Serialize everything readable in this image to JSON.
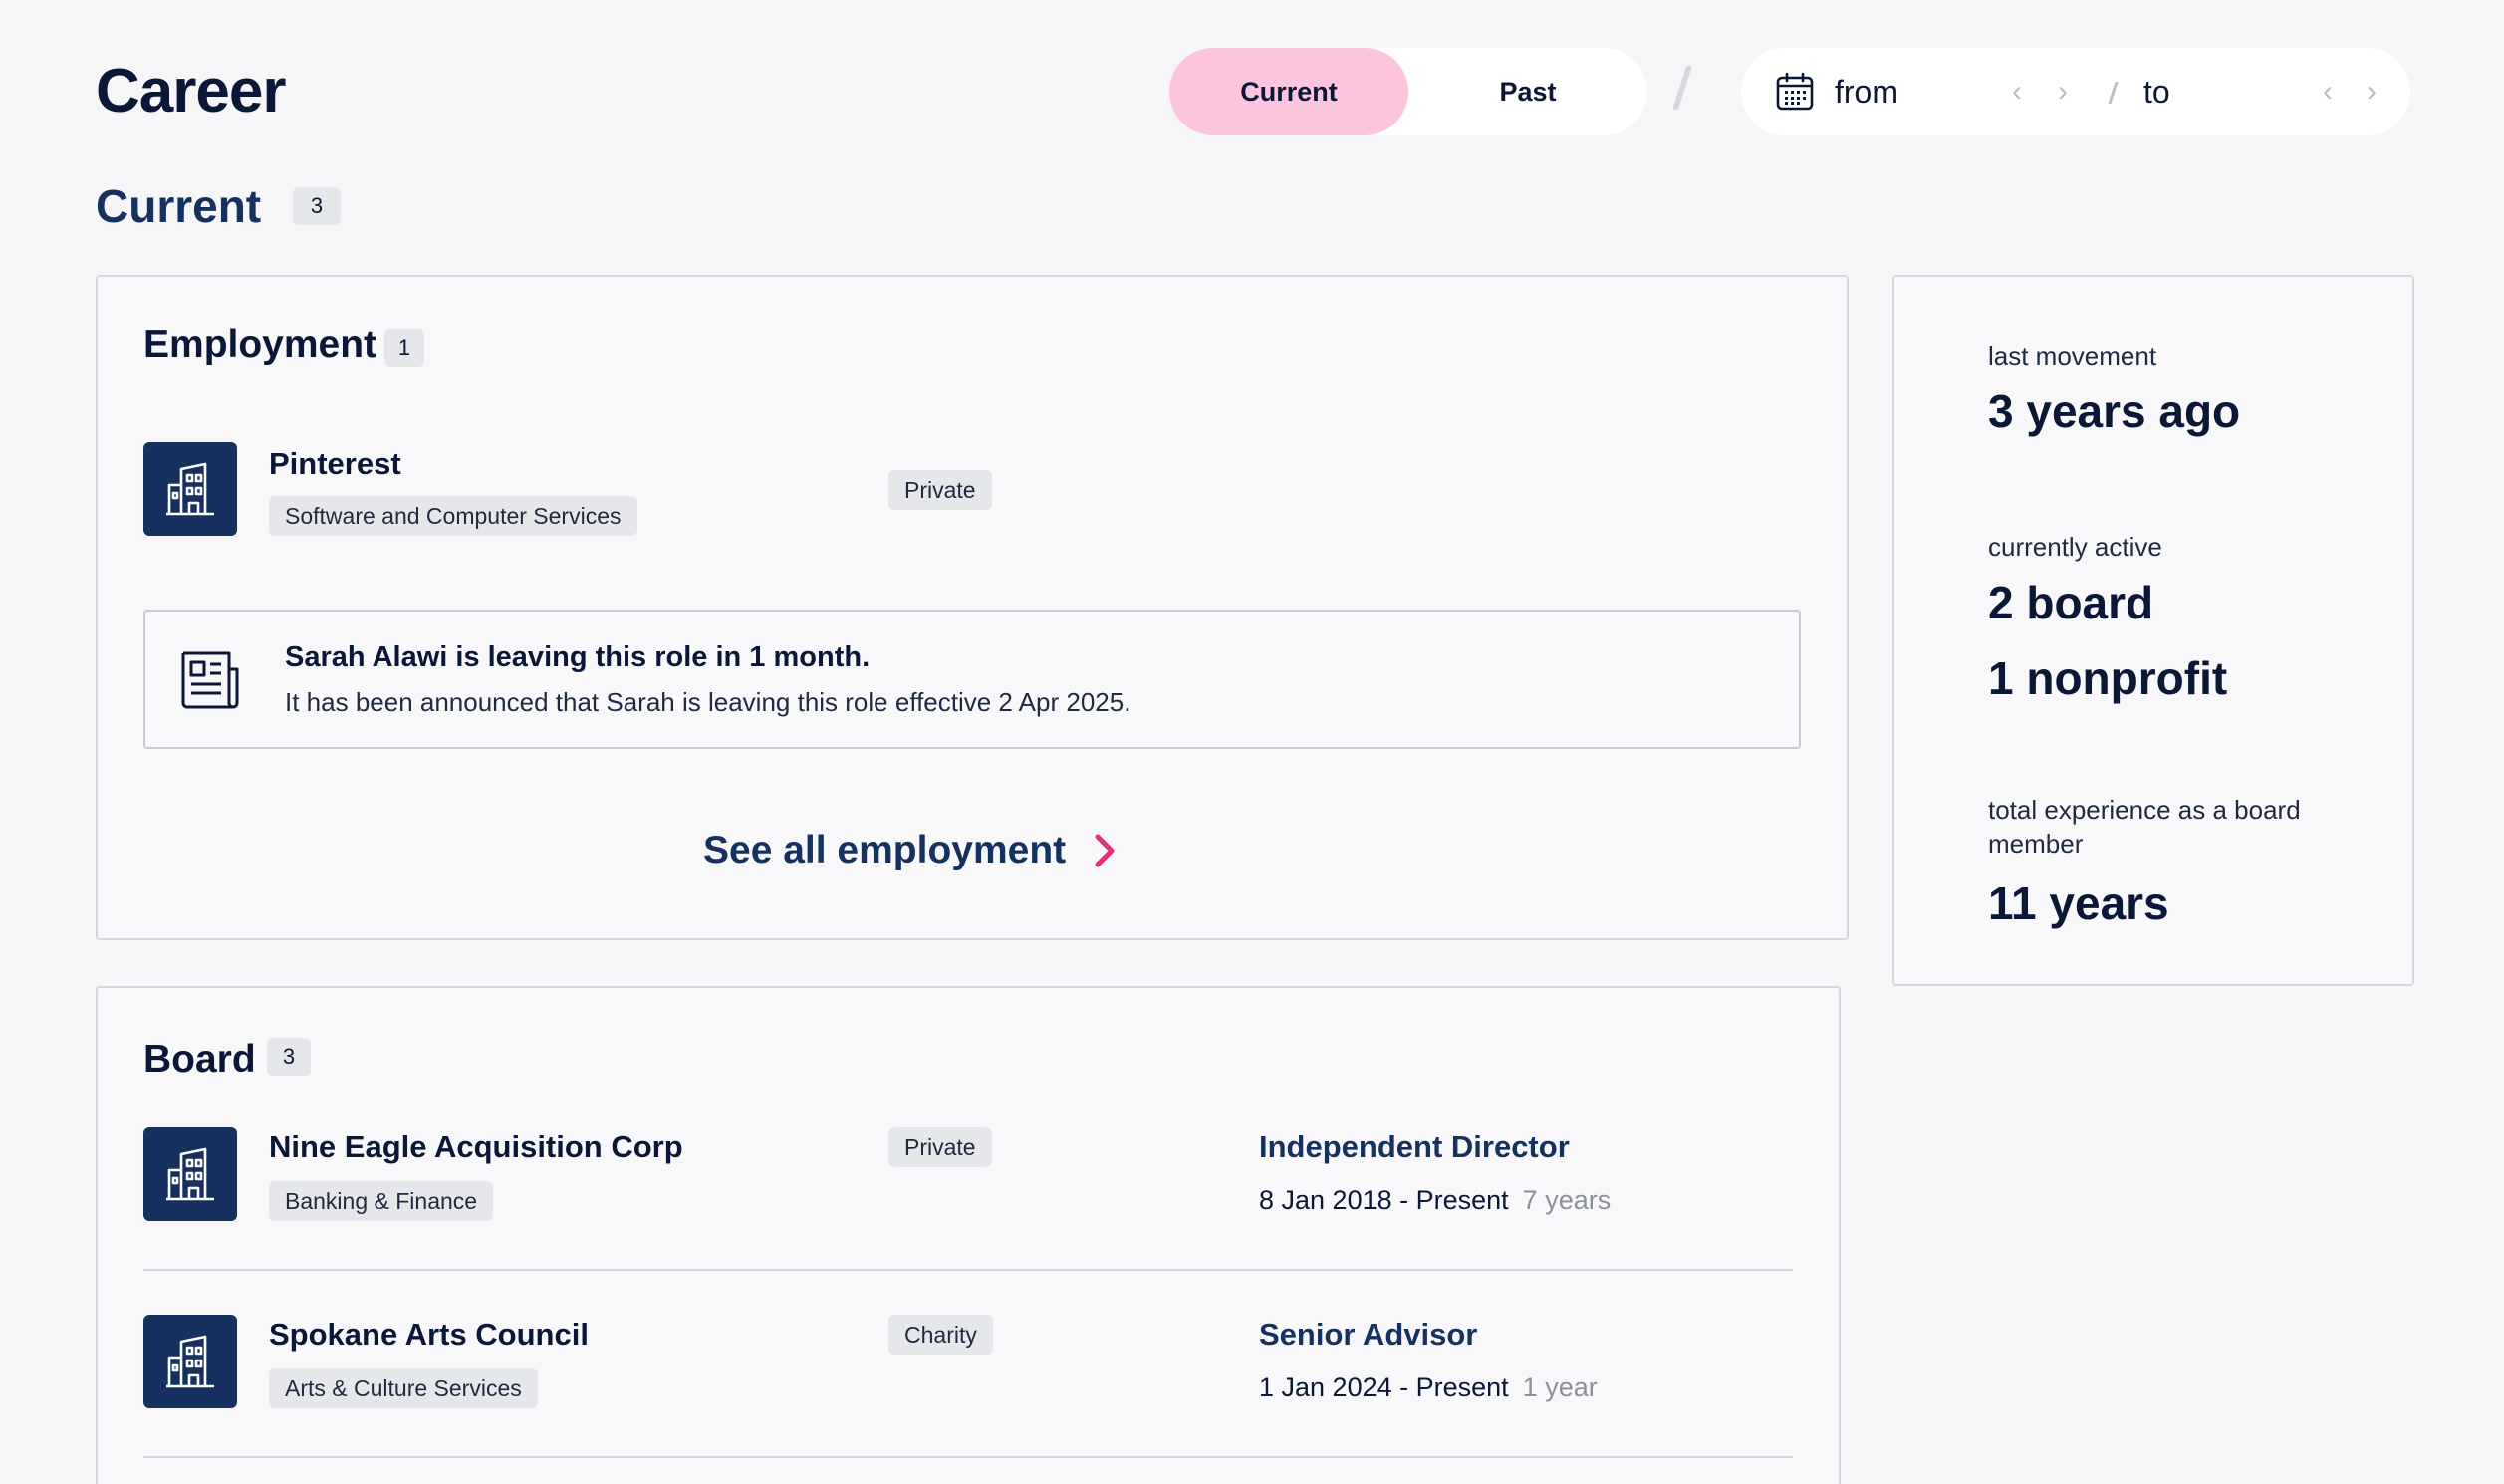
{
  "header": {
    "title": "Career",
    "toggle": {
      "current": "Current",
      "past": "Past"
    },
    "range": {
      "from": "from",
      "to": "to"
    }
  },
  "section": {
    "title": "Current",
    "count": "3"
  },
  "employment": {
    "title": "Employment",
    "count": "1",
    "org": {
      "name": "Pinterest",
      "industry": "Software and Computer Services",
      "type": "Private"
    },
    "notice": {
      "title": "Sarah Alawi is leaving this role in 1 month.",
      "body": "It has been announced that Sarah is leaving this role effective 2 Apr 2025."
    },
    "see_all": "See all employment"
  },
  "board": {
    "title": "Board",
    "count": "3",
    "items": [
      {
        "name": "Nine Eagle Acquisition Corp",
        "industry": "Banking & Finance",
        "type": "Private",
        "role": "Independent Director",
        "dates": "8 Jan 2018 - Present",
        "duration": "7 years"
      },
      {
        "name": "Spokane Arts Council",
        "industry": "Arts & Culture Services",
        "type": "Charity",
        "role": "Senior Advisor",
        "dates": "1 Jan 2024 - Present",
        "duration": "1 year"
      }
    ]
  },
  "stats": {
    "last_movement_label": "last movement",
    "last_movement_value": "3 years ago",
    "active_label": "currently active",
    "active_board": "2 board",
    "active_nonprofit": "1 nonprofit",
    "total_label": "total experience as a board member",
    "total_value": "11 years"
  },
  "colors": {
    "accent_pink": "#fbc5de",
    "navy": "#16315f",
    "chevron_pink": "#e4307a"
  }
}
